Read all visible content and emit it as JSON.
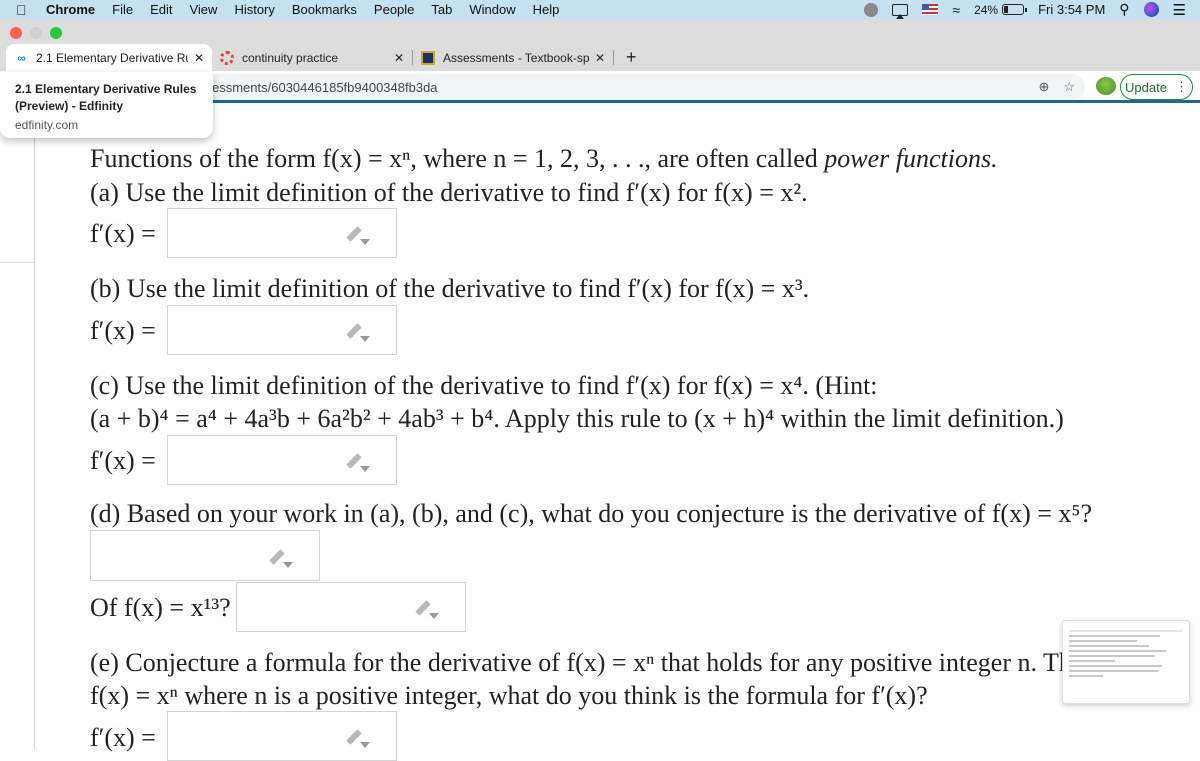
{
  "menubar": {
    "apple": "",
    "items": [
      "Chrome",
      "File",
      "Edit",
      "View",
      "History",
      "Bookmarks",
      "People",
      "Tab",
      "Window",
      "Help"
    ],
    "battery_percent": "24%",
    "battery_level": 0.24,
    "clock": "Fri 3:54 PM"
  },
  "tabs": [
    {
      "title": "2.1 Elementary Derivative Rules",
      "favicon": "edfinity-icon",
      "active": true
    },
    {
      "title": "continuity practice",
      "favicon": "continuity-icon",
      "active": false
    },
    {
      "title": "Assessments - Textbook-speci",
      "favicon": "assessments-icon",
      "active": false
    }
  ],
  "toolbar": {
    "url_visible": "essments/6030446185fb9400348fb3da",
    "update_label": "Update"
  },
  "tooltip": {
    "title": "2.1 Elementary Derivative Rules (Preview) - Edfinity",
    "domain": "edfinity.com"
  },
  "problem": {
    "intro": "Functions of the form f(x) = xⁿ, where n = 1, 2, 3, . . ., are often called ",
    "intro_em": "power functions.",
    "a": "(a) Use the limit definition of the derivative to find f′(x) for f(x) = x².",
    "b": "(b) Use the limit definition of the derivative to find f′(x) for f(x) = x³.",
    "c1": "(c) Use the limit definition of the derivative to find f′(x) for f(x) = x⁴. (Hint:",
    "c2": "(a + b)⁴ = a⁴ + 4a³b + 6a²b² + 4ab³ + b⁴. Apply this rule to (x + h)⁴ within the limit definition.)",
    "d": "(d) Based on your work in (a), (b), and (c), what do you conjecture is the derivative of f(x) = x⁵?",
    "d2": "Of f(x) = x¹³?",
    "e1": "(e) Conjecture a formula for the derivative of f(x) = xⁿ that holds for any positive integer n. That is, giv",
    "e2": "f(x) = xⁿ where n is a positive integer, what do you think is the formula for f′(x)?",
    "answer_label": "f′(x) ="
  },
  "answers": {
    "a": "",
    "b": "",
    "c": "",
    "d": "",
    "d13": "",
    "e": ""
  }
}
